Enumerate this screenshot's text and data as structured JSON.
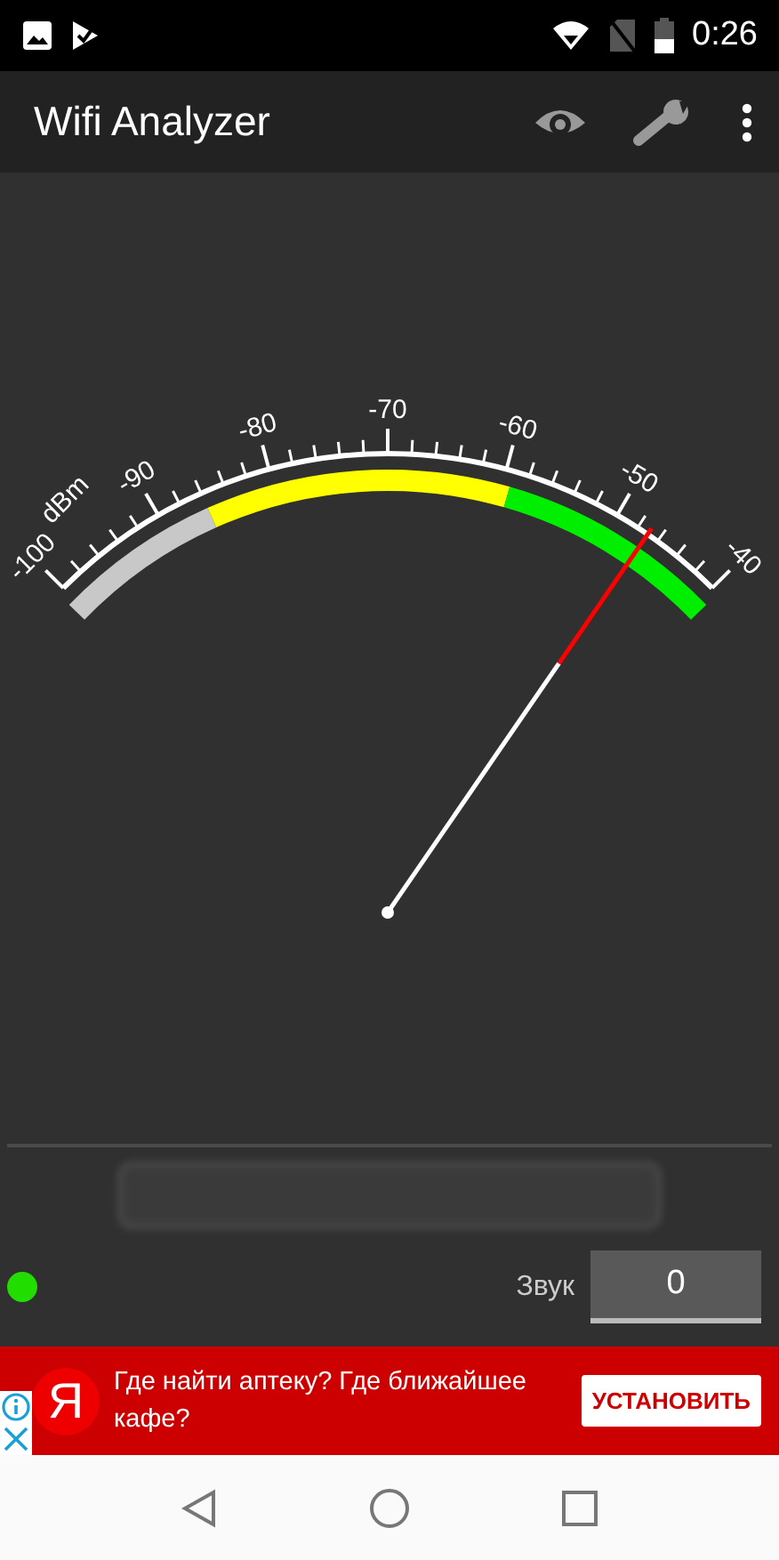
{
  "status_bar": {
    "time": "0:26"
  },
  "app_bar": {
    "title": "Wifi Analyzer"
  },
  "gauge": {
    "unit": "dBm",
    "scale": [
      "-100",
      "-90",
      "-80",
      "-70",
      "-60",
      "-50",
      "-40"
    ]
  },
  "status_dot": {
    "on": true
  },
  "sound": {
    "label": "Звук",
    "value": "0"
  },
  "ad": {
    "logo": "Я",
    "text": "Где найти аптеку? Где ближайшее кафе?",
    "button": "УСТАНОВИТЬ"
  }
}
